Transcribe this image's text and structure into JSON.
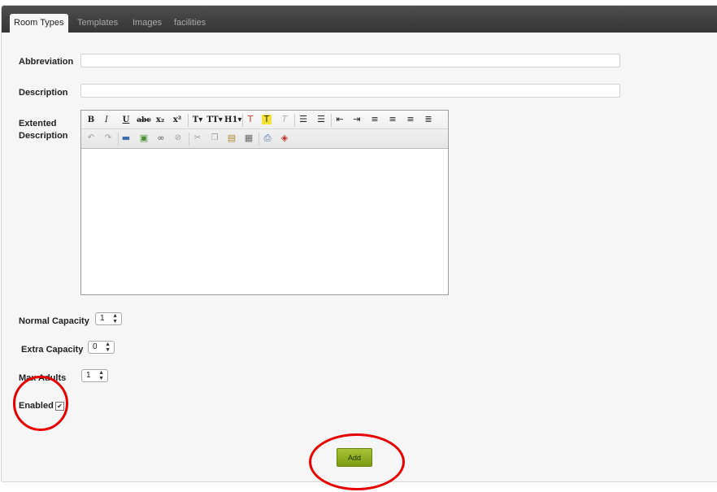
{
  "tabs": [
    {
      "label": "Room Types",
      "active": true
    },
    {
      "label": "Templates",
      "active": false
    },
    {
      "label": "Images",
      "active": false
    },
    {
      "label": "facilities",
      "active": false
    }
  ],
  "form": {
    "abbreviation": {
      "label": "Abbreviation",
      "value": ""
    },
    "description": {
      "label": "Description",
      "value": ""
    },
    "extended_description": {
      "label_line1": "Extented",
      "label_line2": "Description",
      "value": ""
    },
    "normal_capacity": {
      "label": "Normal Capacity",
      "value": "1"
    },
    "extra_capacity": {
      "label": "Extra Capacity",
      "value": "0"
    },
    "max_adults": {
      "label": "Max Adults",
      "value": "1"
    },
    "enabled": {
      "label": "Enabled",
      "checked": true
    }
  },
  "editor_toolbar": {
    "bold": "B",
    "italic": "I",
    "underline": "U",
    "strike": "abc",
    "subscript": "x₂",
    "superscript": "x²",
    "font_size": "T▾",
    "font_family": "TT▾",
    "heading": "H1▾"
  },
  "add_button": {
    "label": "Add"
  },
  "colors": {
    "accent": "#8fae1b",
    "tabbar": "#3d3d3d",
    "annotation": "#e60000"
  }
}
